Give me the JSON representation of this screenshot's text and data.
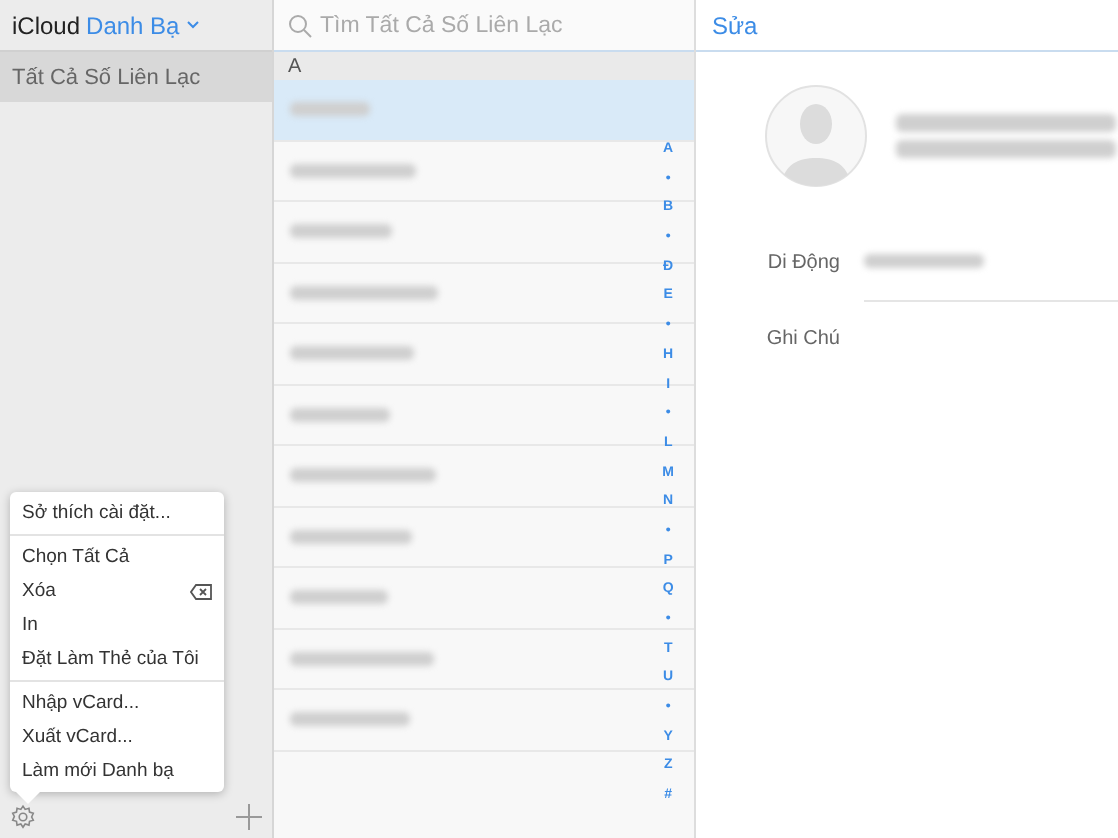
{
  "sidebar": {
    "brand": "iCloud",
    "app_title": "Danh Bạ",
    "groups": [
      {
        "label": "Tất Cả Số Liên Lạc",
        "selected": true
      }
    ]
  },
  "menu": {
    "groups": [
      [
        {
          "label": "Sở thích cài đặt...",
          "kind": "plain"
        }
      ],
      [
        {
          "label": "Chọn Tất Cả",
          "kind": "plain"
        },
        {
          "label": "Xóa",
          "kind": "delete"
        },
        {
          "label": "In",
          "kind": "plain"
        },
        {
          "label": "Đặt Làm Thẻ của Tôi",
          "kind": "plain"
        }
      ],
      [
        {
          "label": "Nhập vCard...",
          "kind": "plain"
        },
        {
          "label": "Xuất vCard...",
          "kind": "plain"
        },
        {
          "label": "Làm mới Danh bạ",
          "kind": "plain"
        }
      ]
    ]
  },
  "search": {
    "placeholder": "Tìm Tất Cả Số Liên Lạc"
  },
  "section": "A",
  "contacts": [
    {
      "selected": true
    },
    {
      "selected": false
    },
    {
      "selected": false
    },
    {
      "selected": false
    },
    {
      "selected": false
    },
    {
      "selected": false
    },
    {
      "selected": false
    },
    {
      "selected": false
    },
    {
      "selected": false
    },
    {
      "selected": false
    },
    {
      "selected": false
    }
  ],
  "index": [
    "A",
    "•",
    "B",
    "•",
    "Đ",
    "E",
    "•",
    "H",
    "I",
    "•",
    "L",
    "M",
    "N",
    "•",
    "P",
    "Q",
    "•",
    "T",
    "U",
    "•",
    "Y",
    "Z",
    "#"
  ],
  "detail": {
    "edit": "Sửa",
    "fields": [
      {
        "label": "Di Động"
      },
      {
        "label": "Ghi Chú"
      }
    ]
  }
}
